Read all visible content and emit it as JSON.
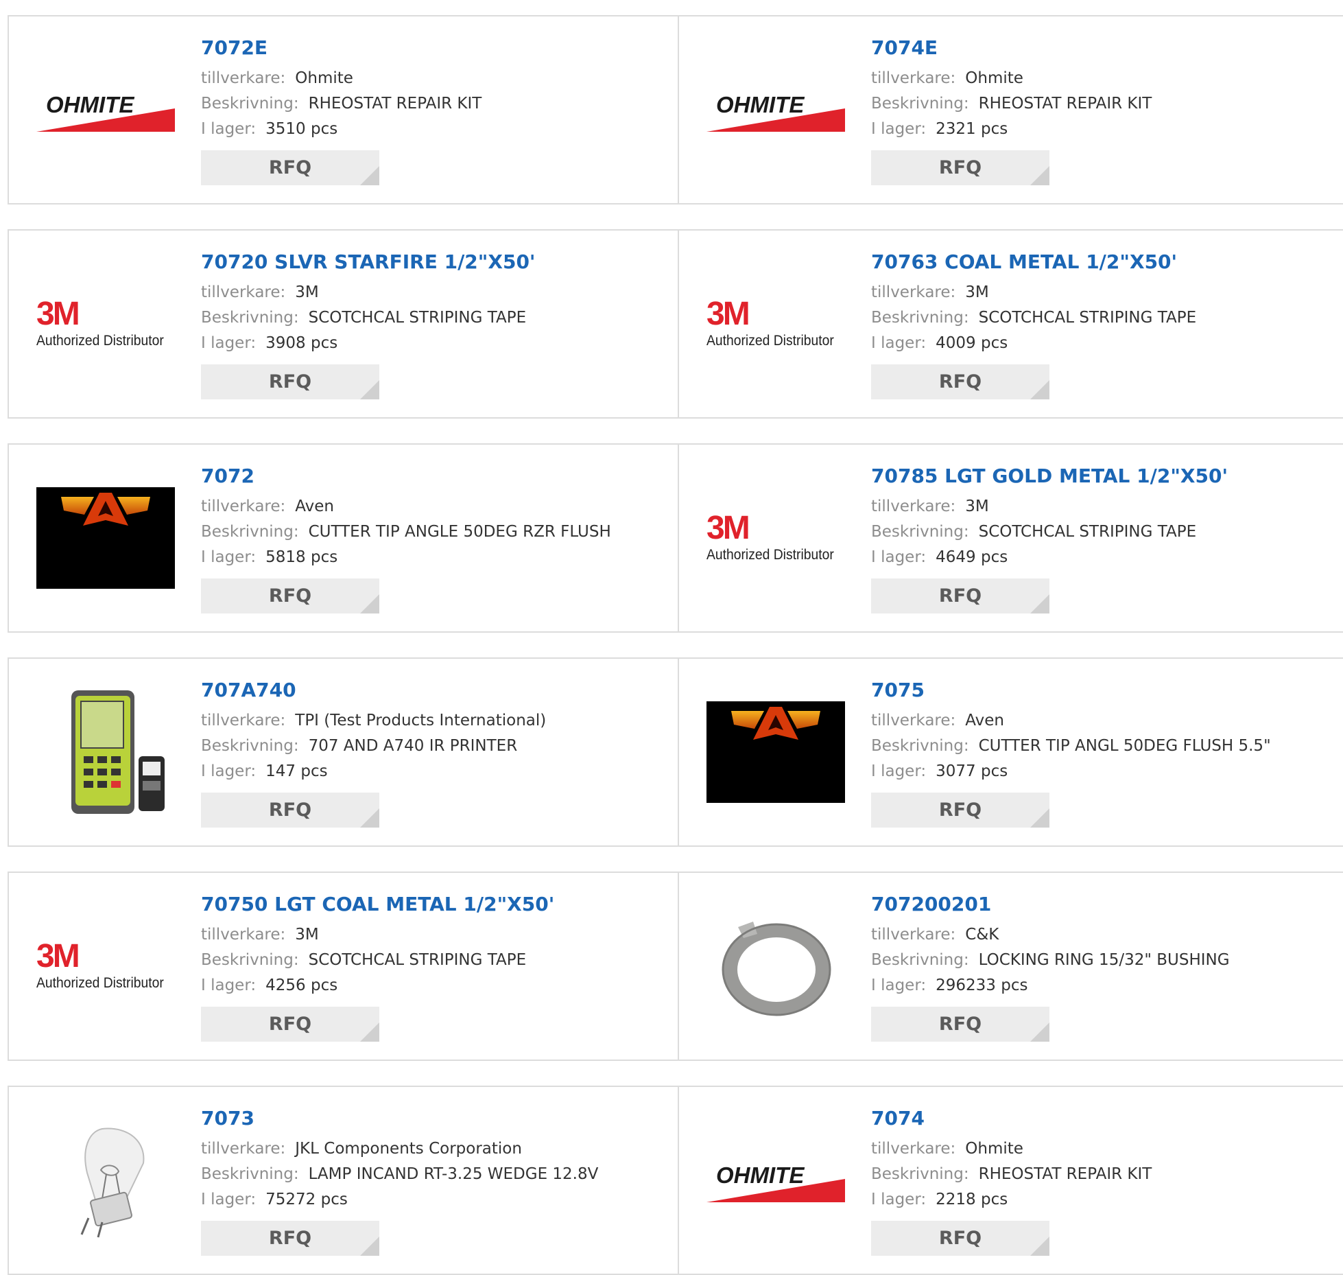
{
  "labels": {
    "manufacturer": "tillverkare:",
    "description": "Beskrivning:",
    "stock": "I lager:",
    "rfq": "RFQ"
  },
  "logos": {
    "ohmite": {
      "text": "OHMITE",
      "color": "#e0222b"
    },
    "3m": {
      "mark": "3M",
      "subtitle": "Authorized Distributor",
      "color": "#e0222b"
    }
  },
  "products": [
    {
      "part": "7072E",
      "manufacturer": "Ohmite",
      "description": "RHEOSTAT REPAIR KIT",
      "stock": "3510 pcs",
      "logo": "ohmite"
    },
    {
      "part": "7074E",
      "manufacturer": "Ohmite",
      "description": "RHEOSTAT REPAIR KIT",
      "stock": "2321 pcs",
      "logo": "ohmite"
    },
    {
      "part": "70720 SLVR STARFIRE 1/2\"X50'",
      "manufacturer": "3M",
      "description": "SCOTCHCAL STRIPING TAPE",
      "stock": "3908 pcs",
      "logo": "3m"
    },
    {
      "part": "70763 COAL METAL 1/2\"X50'",
      "manufacturer": "3M",
      "description": "SCOTCHCAL STRIPING TAPE",
      "stock": "4009 pcs",
      "logo": "3m"
    },
    {
      "part": "7072",
      "manufacturer": "Aven",
      "description": "CUTTER TIP ANGLE 50DEG RZR FLUSH",
      "stock": "5818 pcs",
      "logo": "aven"
    },
    {
      "part": "70785 LGT GOLD METAL 1/2\"X50'",
      "manufacturer": "3M",
      "description": "SCOTCHCAL STRIPING TAPE",
      "stock": "4649 pcs",
      "logo": "3m"
    },
    {
      "part": "707A740",
      "manufacturer": "TPI (Test Products International)",
      "description": "707 AND A740 IR PRINTER",
      "stock": "147 pcs",
      "logo": "tpi"
    },
    {
      "part": "7075",
      "manufacturer": "Aven",
      "description": "CUTTER TIP ANGL 50DEG FLUSH 5.5\"",
      "stock": "3077 pcs",
      "logo": "aven"
    },
    {
      "part": "70750 LGT COAL METAL 1/2\"X50'",
      "manufacturer": "3M",
      "description": "SCOTCHCAL STRIPING TAPE",
      "stock": "4256 pcs",
      "logo": "3m"
    },
    {
      "part": "707200201",
      "manufacturer": "C&K",
      "description": "LOCKING RING 15/32\" BUSHING",
      "stock": "296233 pcs",
      "logo": "ring"
    },
    {
      "part": "7073",
      "manufacturer": "JKL Components Corporation",
      "description": "LAMP INCAND RT-3.25 WEDGE 12.8V",
      "stock": "75272 pcs",
      "logo": "lamp"
    },
    {
      "part": "7074",
      "manufacturer": "Ohmite",
      "description": "RHEOSTAT REPAIR KIT",
      "stock": "2218 pcs",
      "logo": "ohmite"
    }
  ]
}
